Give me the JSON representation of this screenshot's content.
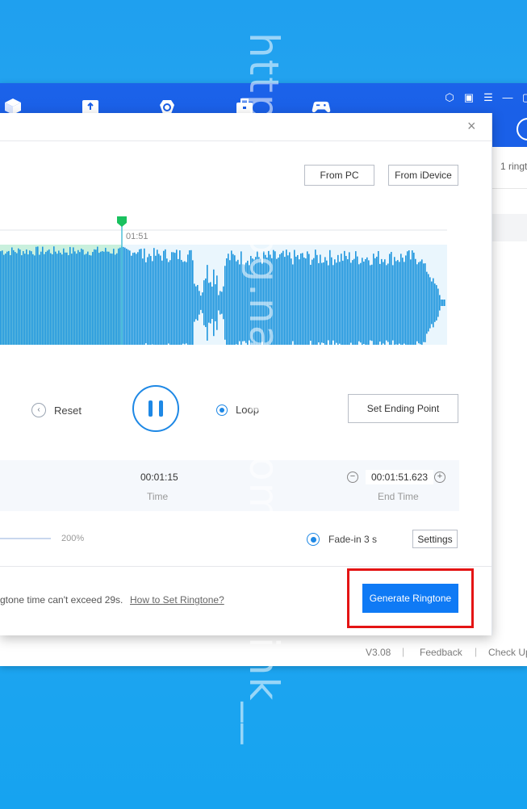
{
  "app": {
    "ringtone_count": "1 ringt",
    "footer": {
      "version": "V3.08",
      "sep1": "|",
      "feedback": "Feedback",
      "sep2": "|",
      "check_update": "Check Up"
    }
  },
  "dialog": {
    "close_glyph": "×",
    "from_pc": "From PC",
    "from_idevice": "From iDevice",
    "playhead_time": "01:51",
    "controls": {
      "reset": "Reset",
      "loop": "Loop",
      "set_ending_point": "Set Ending Point"
    },
    "time_panel": {
      "time_value": "00:01:15",
      "time_label": "Time",
      "end_time_value": "00:01:51.623",
      "end_time_label": "End Time",
      "minus": "−",
      "plus": "+"
    },
    "volume_percent": "200%",
    "fade_in": "Fade-in 3 s",
    "settings": "Settings",
    "footer_note": "gtone time can't exceed 29s.",
    "how_to_link": "How to Set Ringtone?",
    "generate": "Generate Ringtone"
  },
  "watermark": "https://blog.naver.com/nothink__",
  "colors": {
    "desktop": "#1fa0ef",
    "titlebar": "#1a5ee6",
    "accent": "#0f7af5",
    "wave": "#1e96de",
    "wave_selected_bg": "#c9f0dd",
    "playhead": "#19c15f",
    "highlight_box": "#e41414"
  }
}
